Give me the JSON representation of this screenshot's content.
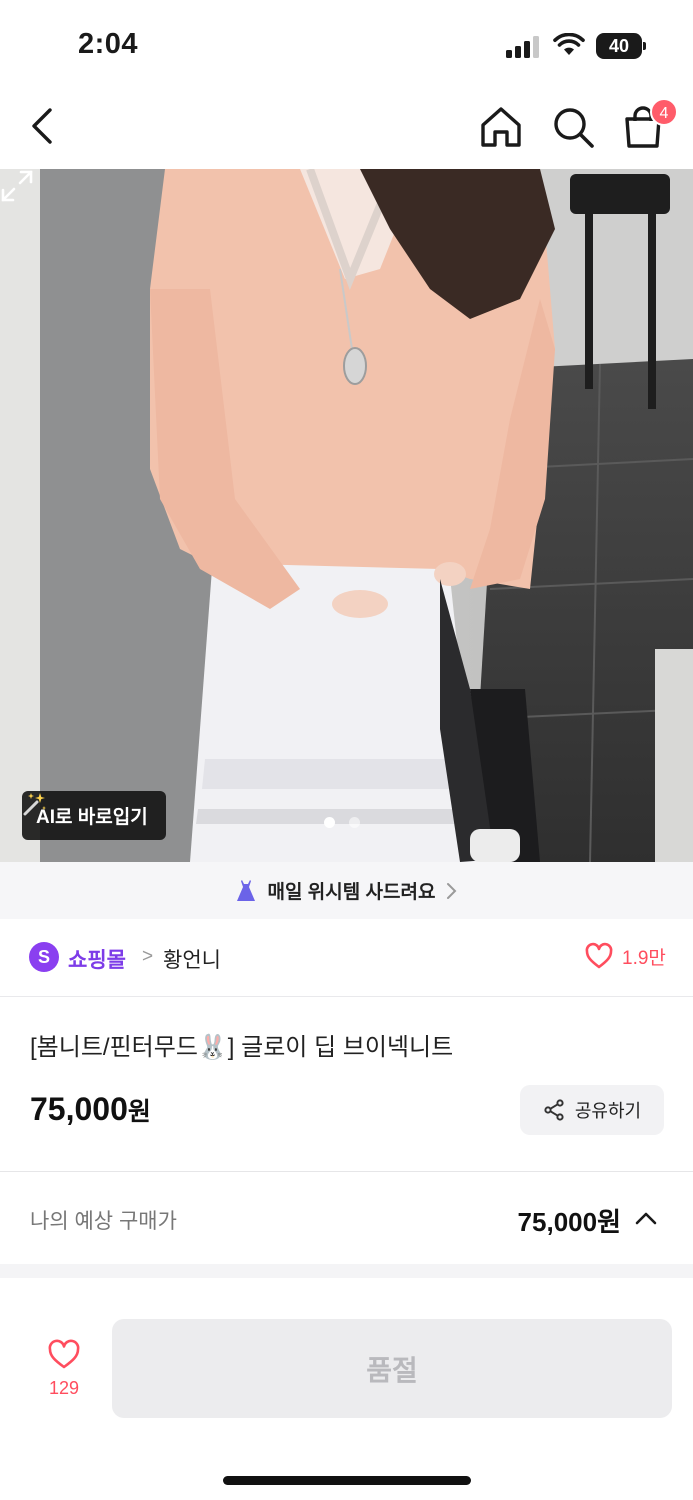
{
  "status_bar": {
    "time": "2:04",
    "battery": "40"
  },
  "nav": {
    "cart_count": "4"
  },
  "image": {
    "ai_button_label": "AI로 바로입기",
    "page_count": 2,
    "active_page": 1
  },
  "promo": {
    "text": "매일 위시템 사드려요"
  },
  "shop": {
    "badge": "S",
    "mall_name": "쇼핑몰",
    "separator": ">",
    "brand": "황언니",
    "likes": "1.9만"
  },
  "product": {
    "title": "[봄니트/핀터무드🐰] 글로이 딥 브이넥니트",
    "price_number": "75,000",
    "price_unit": "원",
    "share_label": "공유하기"
  },
  "expected": {
    "label": "나의 예상 구매가",
    "price": "75,000원"
  },
  "bottom": {
    "wish_count": "129",
    "soldout_label": "품절"
  },
  "colors": {
    "accent": "#7d3ce8",
    "like": "#ff4d5e",
    "badge": "#ff5c6a"
  }
}
